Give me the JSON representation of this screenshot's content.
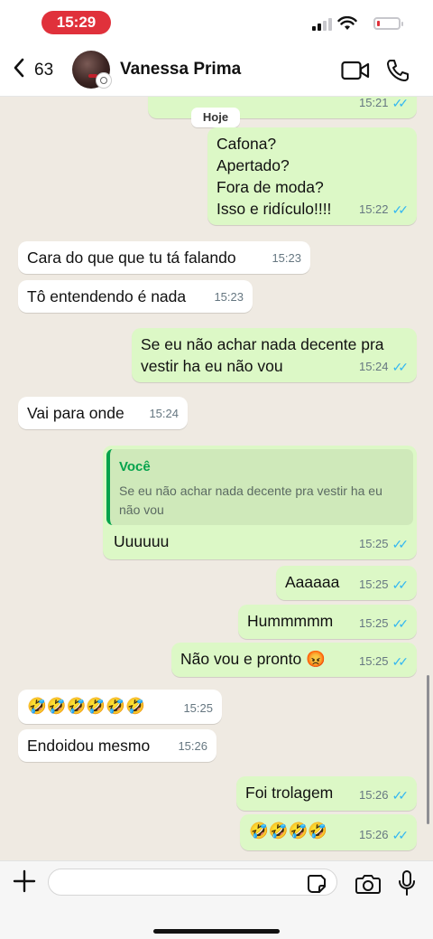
{
  "status_bar": {
    "time": "15:29"
  },
  "header": {
    "back_count": "63",
    "contact_name": "Vanessa Prima"
  },
  "chat": {
    "date_chip": "Hoje",
    "messages": [
      {
        "id": "m0",
        "dir": "out",
        "text": "",
        "time": "15:21",
        "read": true
      },
      {
        "id": "m1",
        "dir": "out",
        "lines": [
          "Cafona?",
          "Apertado?",
          "Fora de moda?",
          "Isso e ridículo!!!!"
        ],
        "time": "15:22",
        "read": true
      },
      {
        "id": "m2",
        "dir": "in",
        "text": "Cara do que que tu tá falando",
        "time": "15:23"
      },
      {
        "id": "m3",
        "dir": "in",
        "text": "Tô entendendo é nada",
        "time": "15:23"
      },
      {
        "id": "m4",
        "dir": "out",
        "lines": [
          "Se eu não achar nada decente pra",
          "vestir ha eu não vou"
        ],
        "time": "15:24",
        "read": true
      },
      {
        "id": "m5",
        "dir": "in",
        "text": "Vai para onde",
        "time": "15:24"
      },
      {
        "id": "m6",
        "dir": "out",
        "quote_author": "Você",
        "quote_text": "Se eu não achar nada decente pra vestir ha eu não vou",
        "text": "Uuuuuu",
        "time": "15:25",
        "read": true
      },
      {
        "id": "m7",
        "dir": "out",
        "text": "Aaaaaa",
        "time": "15:25",
        "read": true
      },
      {
        "id": "m8",
        "dir": "out",
        "text": "Hummmmm",
        "time": "15:25",
        "read": true
      },
      {
        "id": "m9",
        "dir": "out",
        "text": "Não vou e pronto 😡",
        "time": "15:25",
        "read": true
      },
      {
        "id": "m10",
        "dir": "in",
        "text": "🤣🤣🤣🤣🤣🤣",
        "time": "15:25"
      },
      {
        "id": "m11",
        "dir": "in",
        "text": "Endoidou mesmo",
        "time": "15:26"
      },
      {
        "id": "m12",
        "dir": "out",
        "text": "Foi trolagem",
        "time": "15:26",
        "read": true
      },
      {
        "id": "m13",
        "dir": "out",
        "text": "🤣🤣🤣🤣",
        "time": "15:26",
        "read": true
      }
    ]
  },
  "composer": {
    "placeholder": ""
  },
  "colors": {
    "outgoing_bubble": "#dcf8c6",
    "incoming_bubble": "#ffffff",
    "read_ticks": "#34b7f1",
    "quote_accent": "#06a34c",
    "time_pill": "#e0313b"
  },
  "icons": [
    "back-chevron-icon",
    "video-call-icon",
    "phone-icon",
    "plus-icon",
    "sticker-icon",
    "camera-icon",
    "microphone-icon",
    "read-ticks-icon"
  ]
}
